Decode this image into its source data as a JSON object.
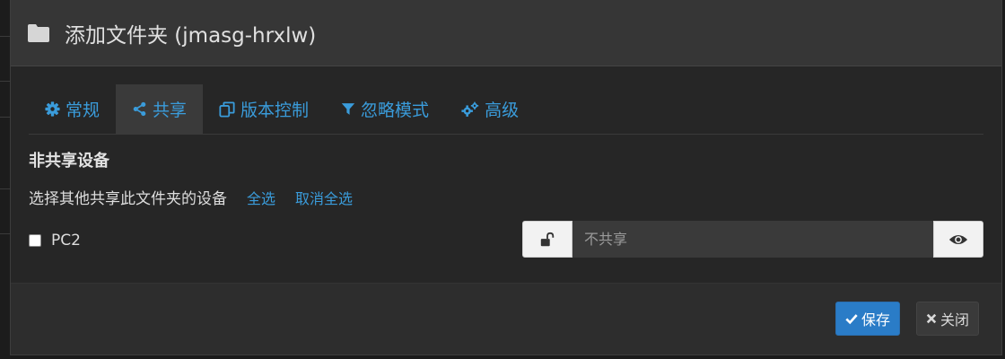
{
  "modal": {
    "title": "添加文件夹 (jmasg-hrxlw)",
    "header_icon": "folder-icon"
  },
  "tabs": [
    {
      "label": "常规",
      "icon": "gear-icon",
      "active": false
    },
    {
      "label": "共享",
      "icon": "share-icon",
      "active": true
    },
    {
      "label": "版本控制",
      "icon": "copy-icon",
      "active": false
    },
    {
      "label": "忽略模式",
      "icon": "filter-icon",
      "active": false
    },
    {
      "label": "高级",
      "icon": "gears-icon",
      "active": false
    }
  ],
  "share_section": {
    "title": "非共享设备",
    "description": "选择其他共享此文件夹的设备",
    "select_all": "全选",
    "deselect_all": "取消全选"
  },
  "devices": [
    {
      "name": "PC2",
      "checked": false,
      "password_placeholder": "不共享"
    }
  ],
  "footer": {
    "save_label": "保存",
    "close_label": "关闭"
  },
  "colors": {
    "accent": "#3a9cdb",
    "primary_button": "#2a7cc7",
    "modal_bg": "#262626",
    "header_bg": "#363636"
  }
}
